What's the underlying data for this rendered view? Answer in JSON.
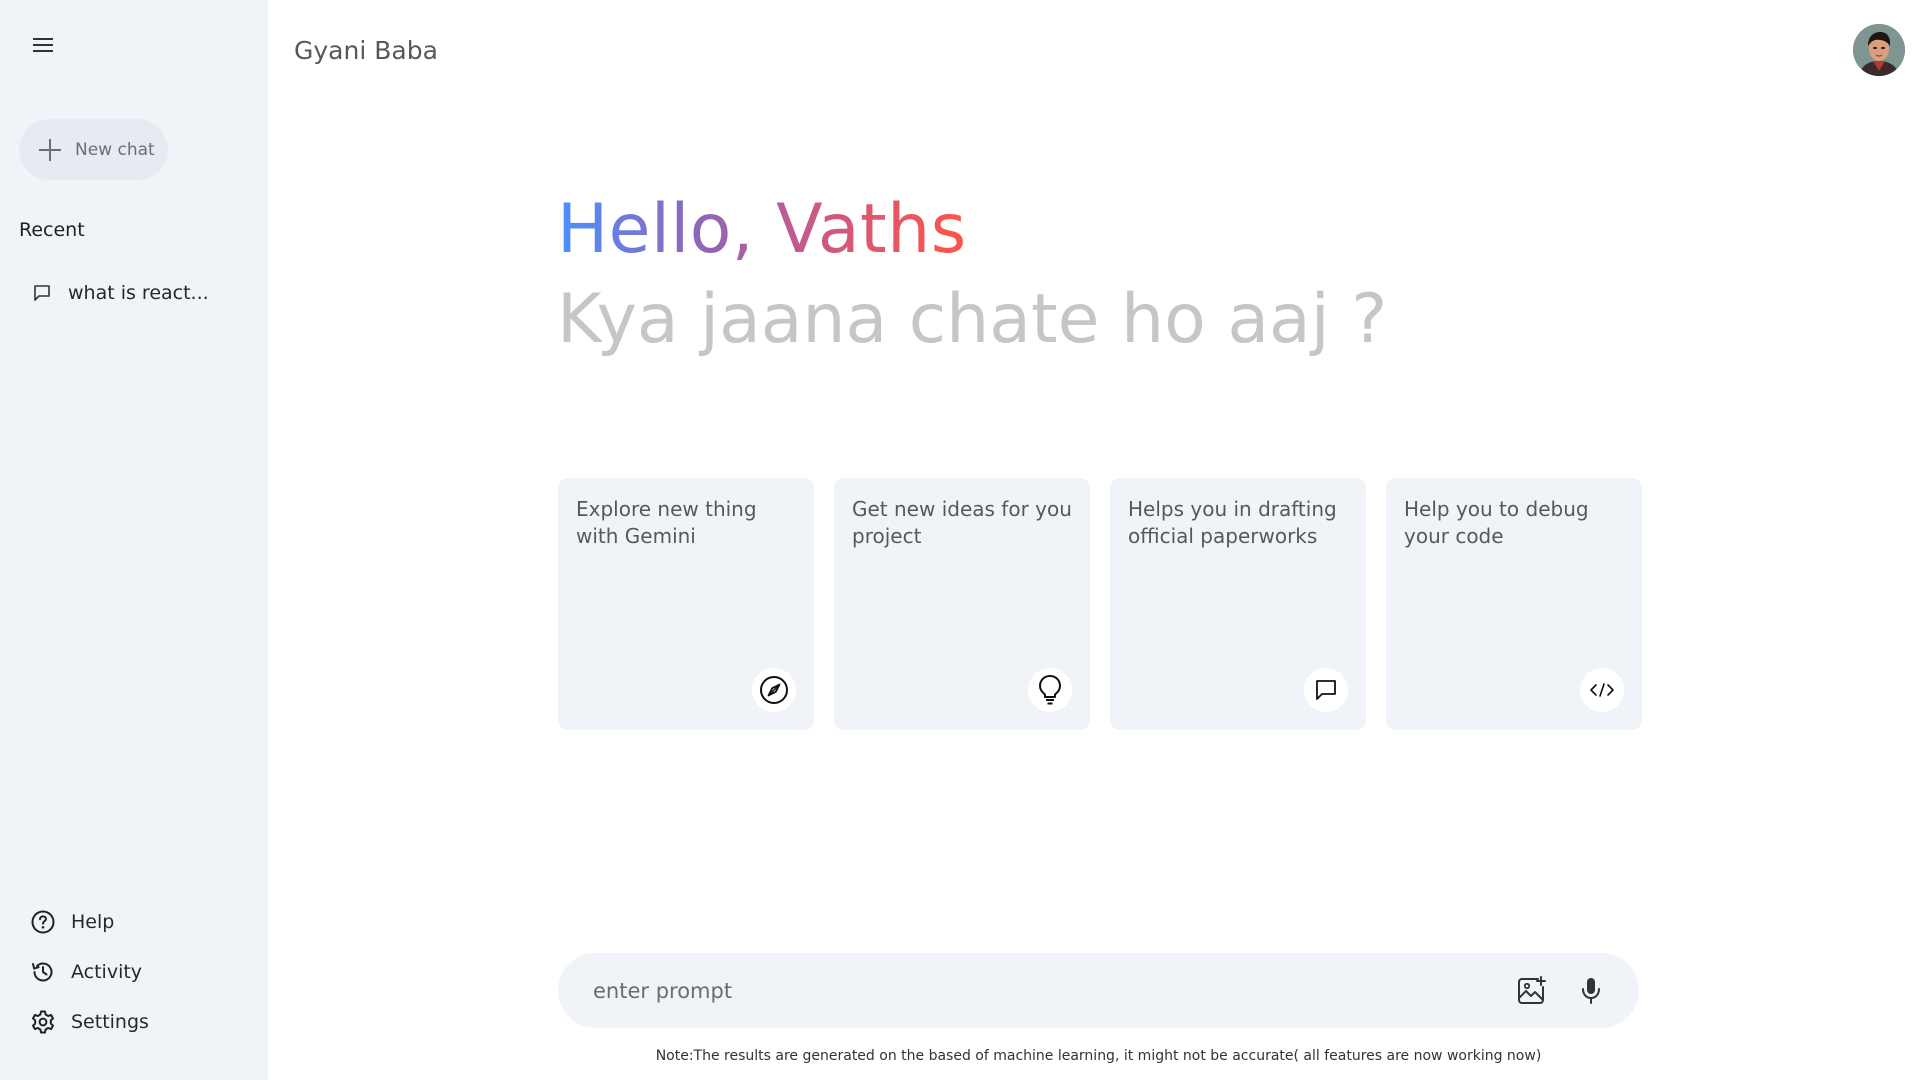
{
  "sidebar": {
    "new_chat_label": "New chat",
    "recent_title": "Recent",
    "recent_items": [
      {
        "label": "what is react..."
      }
    ],
    "bottom_items": [
      {
        "label": "Help",
        "icon": "help-icon"
      },
      {
        "label": "Activity",
        "icon": "history-icon"
      },
      {
        "label": "Settings",
        "icon": "gear-icon"
      }
    ]
  },
  "header": {
    "title": "Gyani Baba"
  },
  "greeting": {
    "hello": "Hello, Vaths",
    "subtitle": "Kya jaana chate ho aaj ?"
  },
  "cards": [
    {
      "text": "Explore new thing with Gemini",
      "icon": "compass-icon"
    },
    {
      "text": "Get new ideas for you project",
      "icon": "bulb-icon"
    },
    {
      "text": "Helps you in drafting official paperworks",
      "icon": "message-icon"
    },
    {
      "text": "Help you to debug your code",
      "icon": "code-icon"
    }
  ],
  "prompt": {
    "placeholder": "enter prompt",
    "value": ""
  },
  "note": "Note:The results are generated on the based of machine learning, it might not be accurate( all features are now working now)",
  "colors": {
    "sidebar_bg": "#f0f4f9",
    "card_bg": "#f0f4f9",
    "gradient_start": "#4b90ff",
    "gradient_end": "#ff5546",
    "muted_text": "#c4c7c5"
  }
}
